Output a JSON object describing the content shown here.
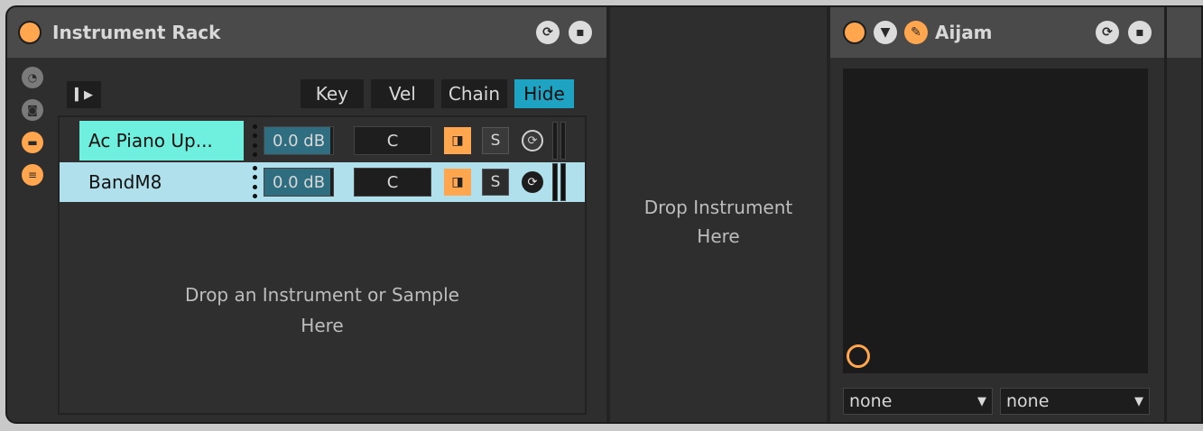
{
  "rack": {
    "title": "Instrument Rack",
    "toolbar": {
      "mini_label": "▍▶",
      "toggles": [
        {
          "label": "Key",
          "active": false
        },
        {
          "label": "Vel",
          "active": false
        },
        {
          "label": "Chain",
          "active": false
        },
        {
          "label": "Hide",
          "active": true
        }
      ]
    },
    "chains": [
      {
        "name": "Ac Piano Up...",
        "volume": "0.0 dB",
        "pan": "C",
        "solo": "S",
        "selected": true
      },
      {
        "name": "BandM8",
        "volume": "0.0 dB",
        "pan": "C",
        "solo": "S",
        "selected": false
      }
    ],
    "drop_text_line1": "Drop an Instrument or Sample",
    "drop_text_line2": "Here"
  },
  "drop_zone": {
    "line1": "Drop Instrument",
    "line2": "Here"
  },
  "aijam": {
    "title": "Aijam",
    "dropdown_left": "none",
    "dropdown_right": "none"
  },
  "colors": {
    "accent_orange": "#ffa64f",
    "selected_chain": "#6ff0de",
    "active_toggle": "#1ea3c3",
    "row_highlight": "#b0e0ec"
  }
}
